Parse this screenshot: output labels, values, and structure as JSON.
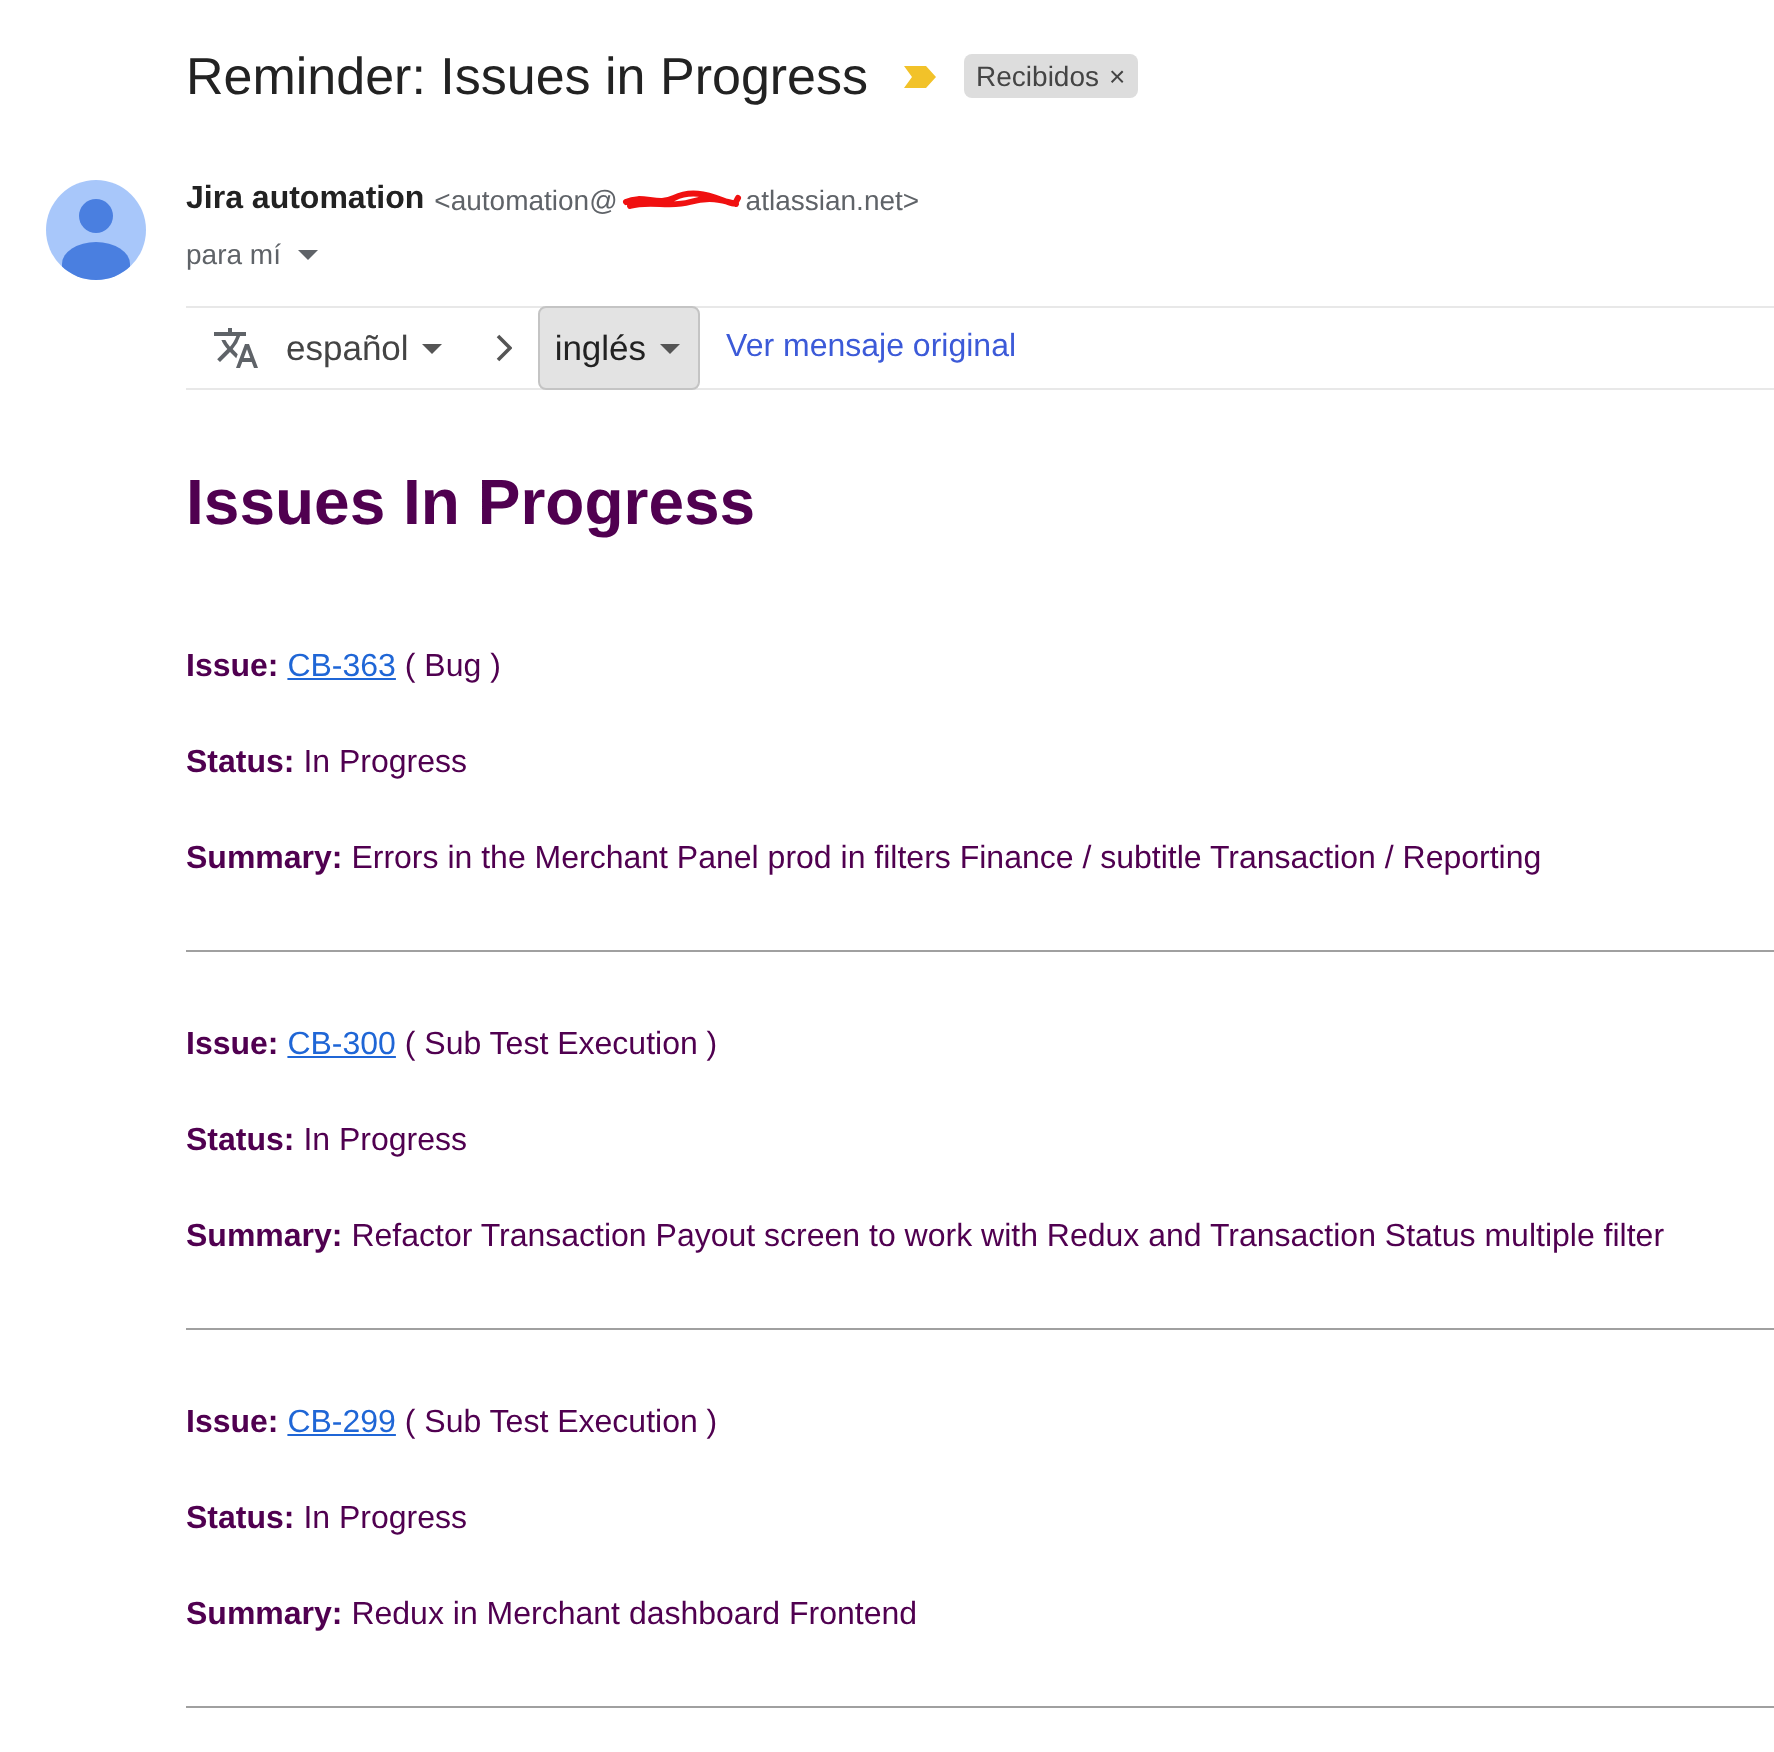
{
  "subject": {
    "title": "Reminder: Issues in Progress",
    "important": true,
    "labels": [
      {
        "name": "Recibidos",
        "remove": "×"
      }
    ]
  },
  "sender": {
    "name": "Jira automation",
    "email_start": "<automation@",
    "email_end": "atlassian.net>",
    "redacted": true,
    "recipient": "para mí"
  },
  "translation": {
    "source_language": "español",
    "target_language": "inglés",
    "original_link": "Ver mensaje original"
  },
  "body": {
    "heading": "Issues In Progress",
    "issues": [
      {
        "issue_label": "Issue:",
        "key": "CB-363",
        "type": "( Bug )",
        "status_label": "Status:",
        "status": "In Progress",
        "summary_label": "Summary:",
        "summary": "Errors in the Merchant Panel prod in filters Finance / subtitle Transaction / Reporting"
      },
      {
        "issue_label": "Issue:",
        "key": "CB-300",
        "type": "( Sub Test Execution )",
        "status_label": "Status:",
        "status": "In Progress",
        "summary_label": "Summary:",
        "summary": "Refactor Transaction Payout screen to work with Redux and Transaction Status multiple filter"
      },
      {
        "issue_label": "Issue:",
        "key": "CB-299",
        "type": "( Sub Test Execution )",
        "status_label": "Status:",
        "status": "In Progress",
        "summary_label": "Summary:",
        "summary": "Redux in Merchant dashboard Frontend"
      }
    ]
  }
}
